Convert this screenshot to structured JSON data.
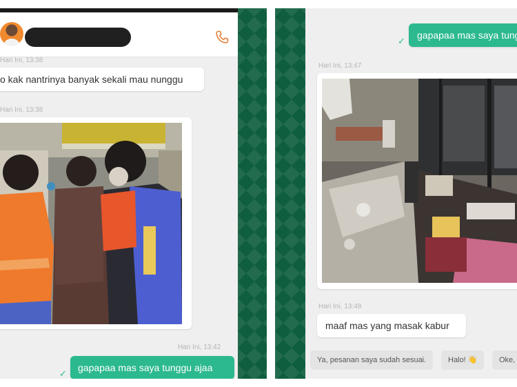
{
  "left_chat": {
    "header": {
      "icon": "phone-icon"
    },
    "messages": [
      {
        "time": "Hari Ini, 13:38",
        "text": "o kak nantrinya banyak sekali mau nunggu"
      },
      {
        "time": "Hari Ini, 13:38"
      },
      {
        "time": "Hari Ini, 13:42",
        "text": "gapapaa mas saya tunggu ajaa"
      }
    ]
  },
  "right_chat": {
    "messages": [
      {
        "text": "gapapaa mas saya tunggu"
      },
      {
        "time": "Hari Ini, 13:47"
      },
      {
        "time": "Hari Ini, 13:48",
        "text": "maaf mas yang masak kabur"
      }
    ],
    "quick_replies": [
      "Ya, pesanan saya sudah sesuai.",
      "Halo! 👋",
      "Oke,"
    ]
  },
  "colors": {
    "accent": "#2cb98f",
    "divider": "#0f5e3f"
  }
}
